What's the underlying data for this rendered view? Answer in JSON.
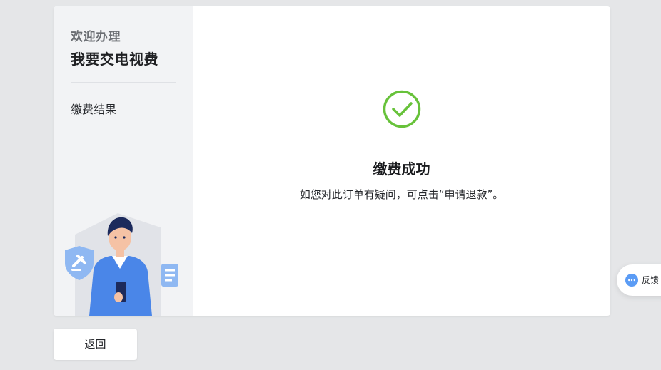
{
  "sidebar": {
    "subtitle": "欢迎办理",
    "title": "我要交电视费",
    "steps": [
      {
        "label": "缴费结果"
      }
    ]
  },
  "result": {
    "icon": "check-circle-icon",
    "title": "缴费成功",
    "description": "如您对此订单有疑问，可点击“申请退款”。"
  },
  "actions": {
    "back_label": "返回"
  },
  "feedback": {
    "icon": "chat-bubble-icon",
    "label": "反馈"
  },
  "colors": {
    "success": "#67c23a",
    "sidebar_bg": "#f2f3f5",
    "page_bg": "#e5e6e8",
    "feedback_accent": "#5b9cf5"
  }
}
